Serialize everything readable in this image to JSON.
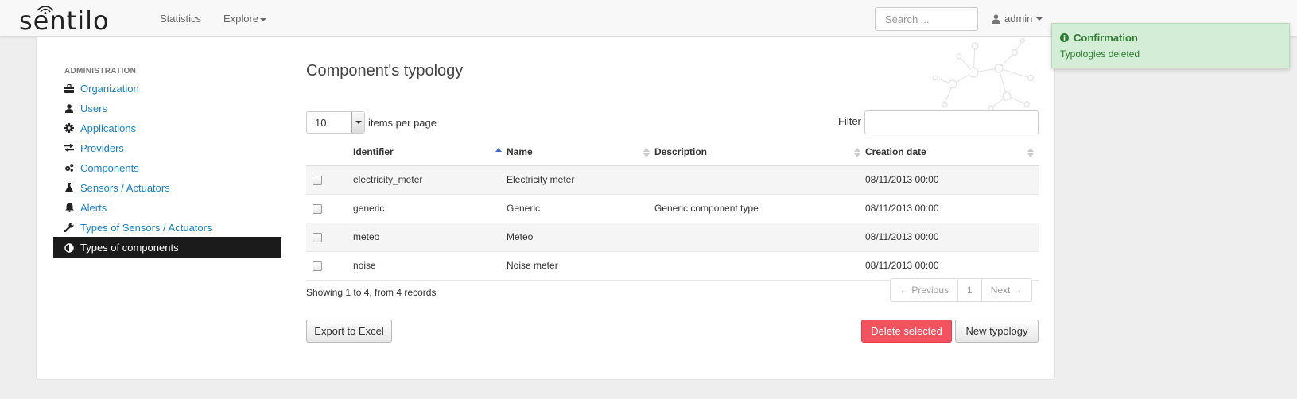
{
  "app": {
    "brand": "sentilo",
    "icons": {
      "brand_signal": "wifi-signal-icon"
    }
  },
  "nav": {
    "statistics": "Statistics",
    "explore": "Explore",
    "search_placeholder": "Search ...",
    "user": "admin",
    "icons": {
      "user": "user-icon",
      "dropdown": "caret-down-icon"
    }
  },
  "sidebar": {
    "header": "ADMINISTRATION",
    "items": [
      {
        "label": "Organization",
        "icon": "briefcase-icon"
      },
      {
        "label": "Users",
        "icon": "user-icon"
      },
      {
        "label": "Applications",
        "icon": "gear-icon"
      },
      {
        "label": "Providers",
        "icon": "exchange-icon"
      },
      {
        "label": "Components",
        "icon": "cogs-icon"
      },
      {
        "label": "Sensors / Actuators",
        "icon": "flask-icon"
      },
      {
        "label": "Alerts",
        "icon": "bell-icon"
      },
      {
        "label": "Types of Sensors / Actuators",
        "icon": "wrench-icon"
      },
      {
        "label": "Types of components",
        "icon": "contrast-icon",
        "active": true
      }
    ]
  },
  "main": {
    "title": "Component's typology",
    "per_page": {
      "value": "10",
      "label": "items per page"
    },
    "filter_label": "Filter",
    "table": {
      "columns": [
        "Identifier",
        "Name",
        "Description",
        "Creation date"
      ],
      "sorted_column": "Identifier",
      "rows": [
        {
          "identifier": "electricity_meter",
          "name": "Electricity meter",
          "description": "",
          "creation_date": "08/11/2013 00:00"
        },
        {
          "identifier": "generic",
          "name": "Generic",
          "description": "Generic component type",
          "creation_date": "08/11/2013 00:00"
        },
        {
          "identifier": "meteo",
          "name": "Meteo",
          "description": "",
          "creation_date": "08/11/2013 00:00"
        },
        {
          "identifier": "noise",
          "name": "Noise meter",
          "description": "",
          "creation_date": "08/11/2013 00:00"
        }
      ]
    },
    "showing": "Showing 1 to 4, from 4 records",
    "pagination": {
      "previous": "← Previous",
      "page": "1",
      "next": "Next →"
    },
    "buttons": {
      "export": "Export to Excel",
      "delete": "Delete selected",
      "new": "New typology"
    }
  },
  "notification": {
    "title": "Confirmation",
    "message": "Typologies deleted",
    "icon": "info-circle-icon"
  },
  "colors": {
    "link": "#1a82c0",
    "active_bg": "#1b1b1b",
    "danger": "#f2535f",
    "toast_bg": "#d4edd6",
    "toast_text": "#2f7d32"
  }
}
